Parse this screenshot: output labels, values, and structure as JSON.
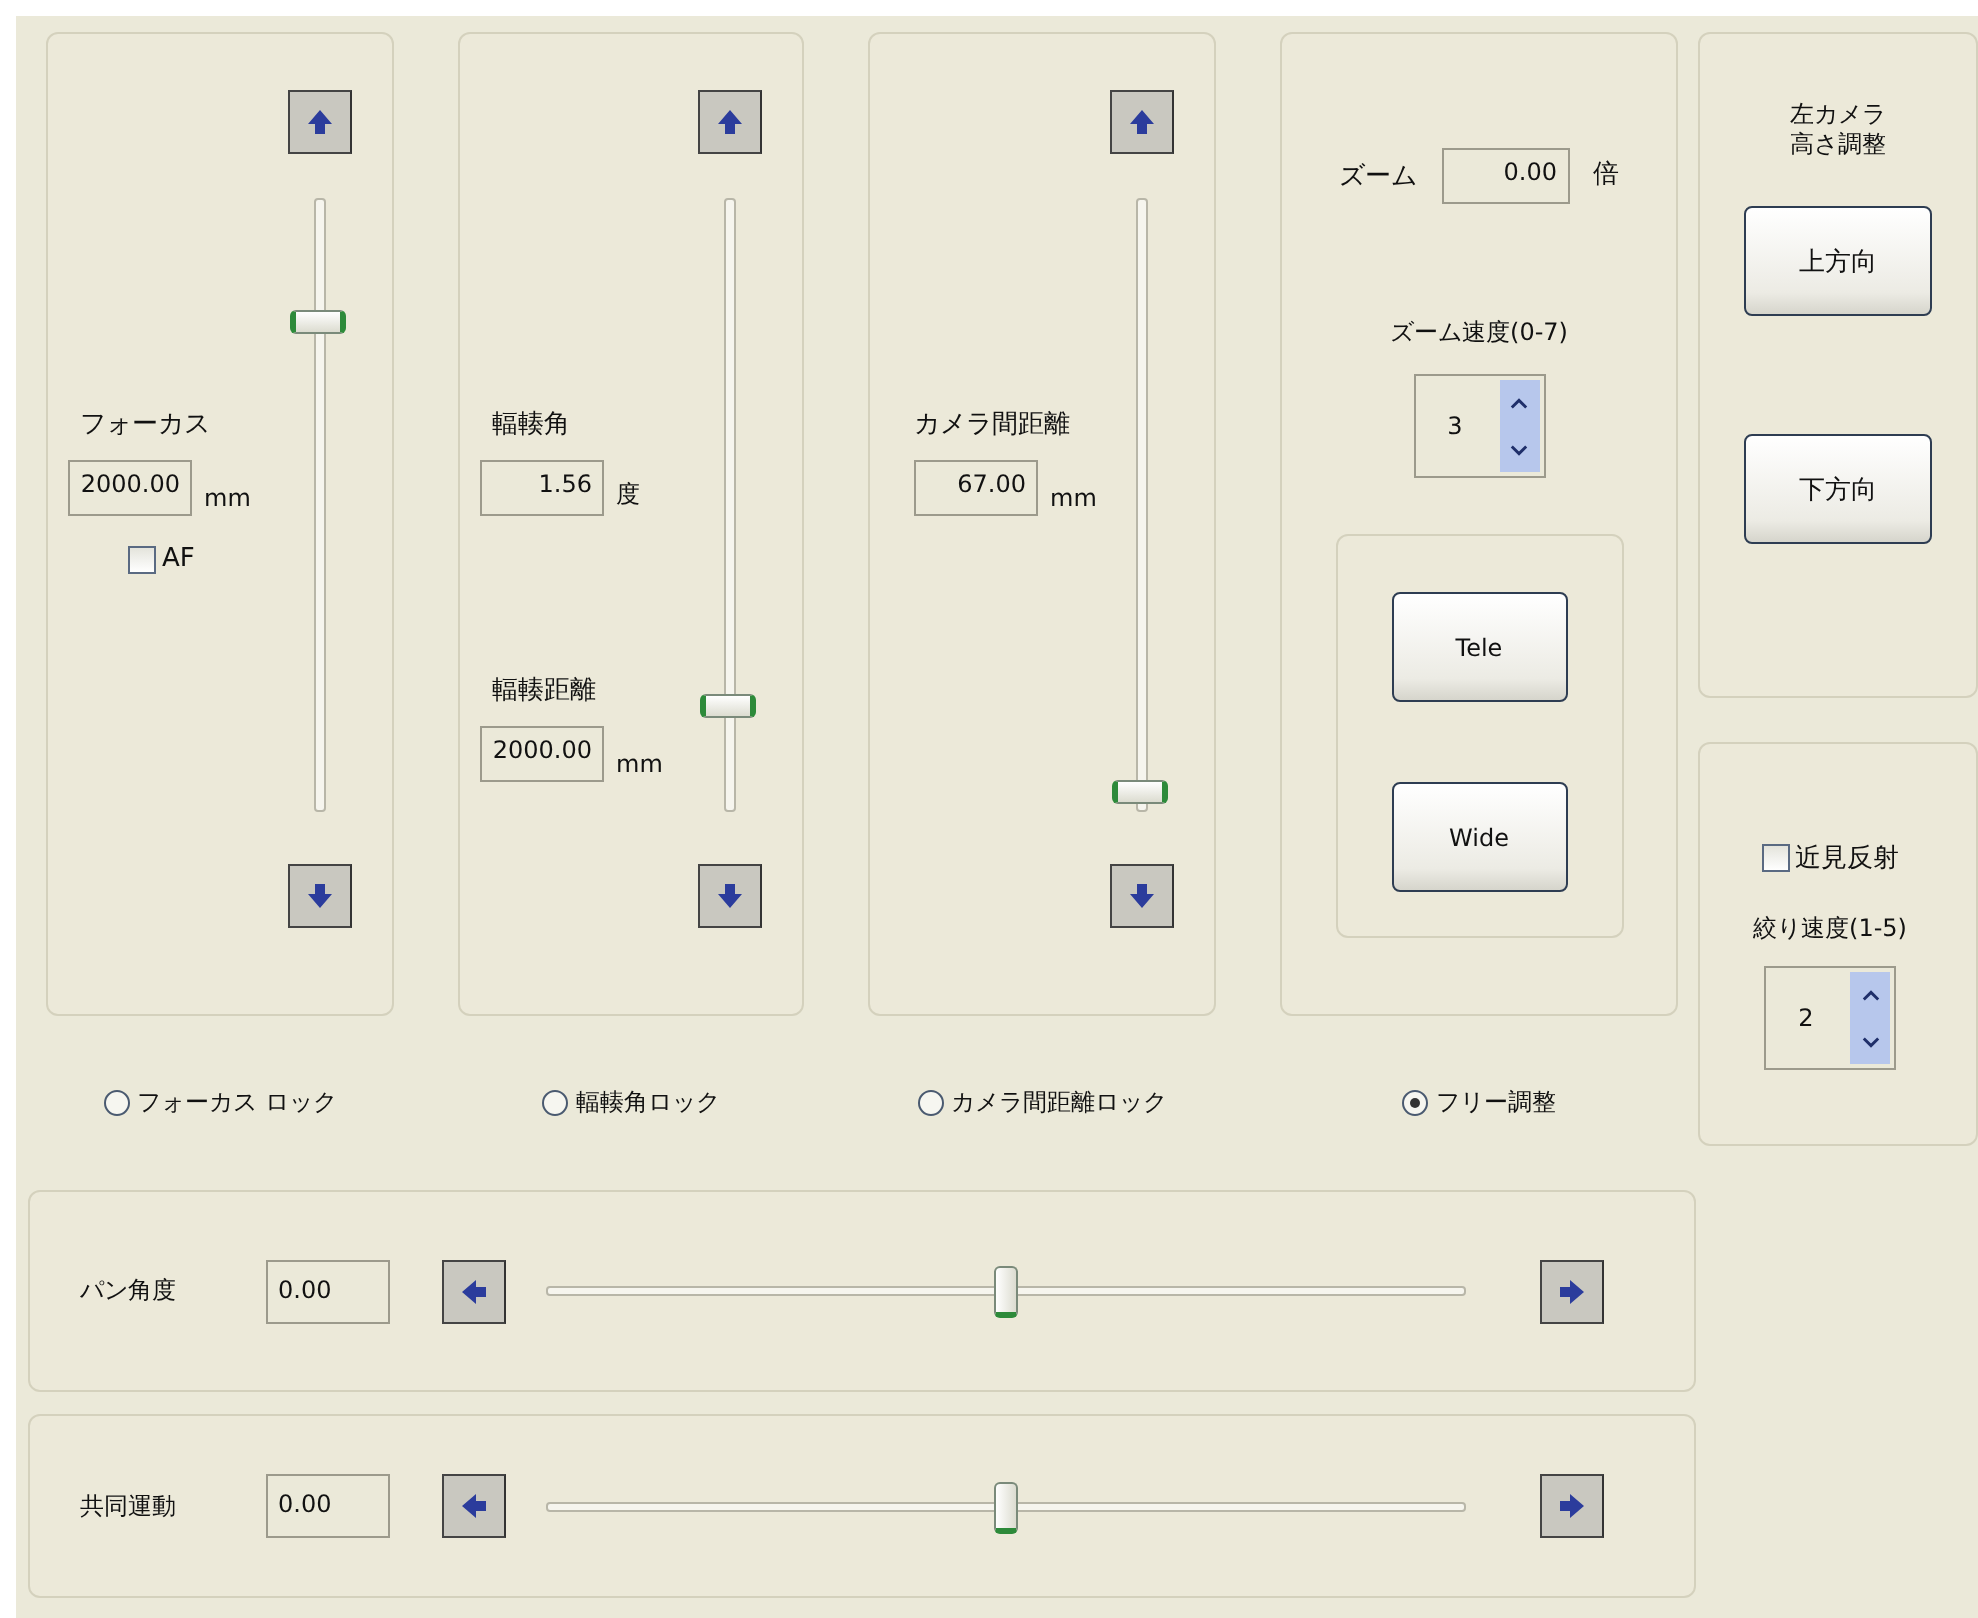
{
  "vertical_panels": [
    {
      "fields": [
        {
          "label": "フォーカス",
          "value": "2000.00",
          "unit": "mm"
        }
      ],
      "checkbox": {
        "label": "AF",
        "checked": false
      },
      "slider": {
        "level": 0.8
      }
    },
    {
      "fields": [
        {
          "label": "輻輳角",
          "value": "1.56",
          "unit": "度"
        },
        {
          "label": "輻輳距離",
          "value": "2000.00",
          "unit": "mm"
        }
      ],
      "slider": {
        "level": 0.17
      }
    },
    {
      "fields": [
        {
          "label": "カメラ間距離",
          "value": "67.00",
          "unit": "mm"
        }
      ],
      "slider": {
        "level": 0.03
      }
    }
  ],
  "zoom": {
    "label": "ズーム",
    "value": "0.00",
    "unit": "倍",
    "speed_label": "ズーム速度(0-7)",
    "speed": "3",
    "buttons": [
      "Tele",
      "Wide"
    ]
  },
  "lock_options": [
    {
      "label": "フォーカス ロック",
      "selected": false
    },
    {
      "label": "輻輳角ロック",
      "selected": false
    },
    {
      "label": "カメラ間距離ロック",
      "selected": false
    },
    {
      "label": "フリー調整",
      "selected": true
    }
  ],
  "camera_height": {
    "title_lines": [
      "左カメラ",
      "高さ調整"
    ],
    "buttons": [
      "上方向",
      "下方向"
    ]
  },
  "iris": {
    "checkbox": {
      "label": "近見反射",
      "checked": false
    },
    "speed_label": "絞り速度(1-5)",
    "speed": "2"
  },
  "horizontal_sliders": [
    {
      "label": "パン角度",
      "value": "0.00",
      "level": 0.5
    },
    {
      "label": "共同運動",
      "value": "0.00",
      "level": 0.5
    }
  ]
}
